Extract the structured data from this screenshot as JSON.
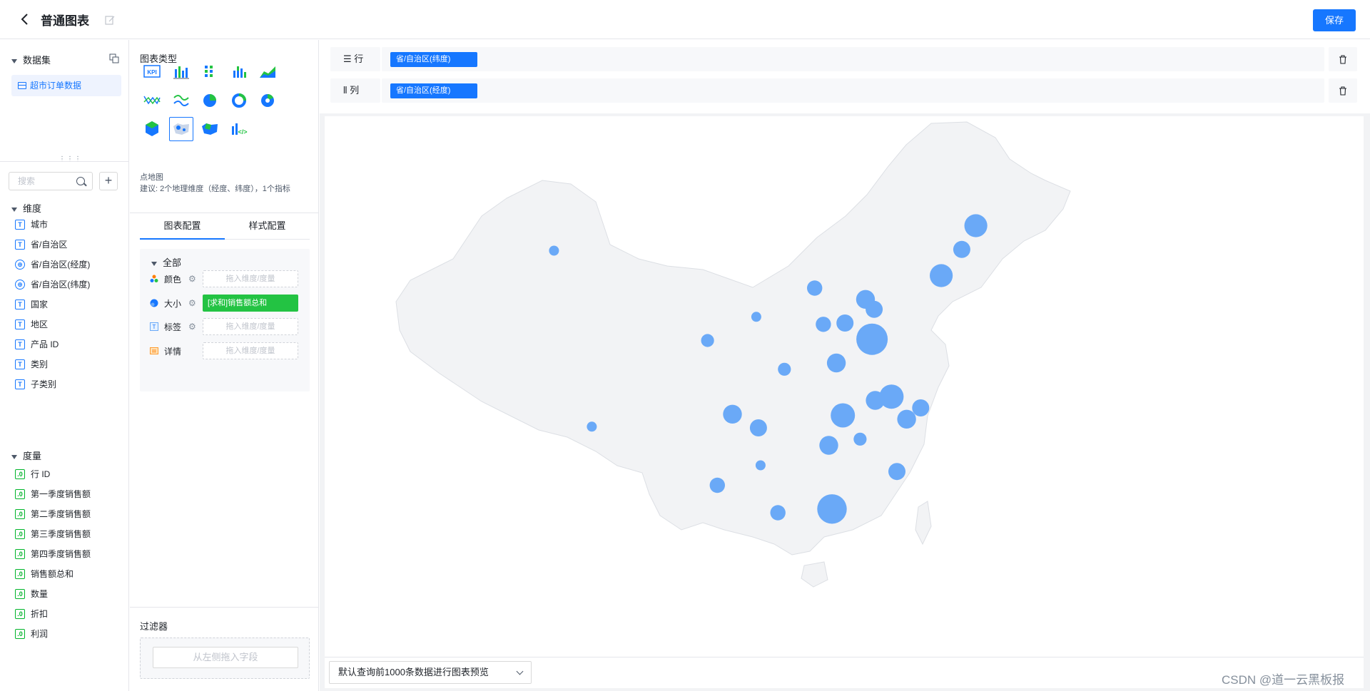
{
  "header": {
    "title": "普通图表",
    "save_label": "保存"
  },
  "left": {
    "dataset_section": "数据集",
    "dataset_item": "超市订单数据",
    "search_placeholder": "搜索",
    "dimension_section": "维度",
    "dimensions": [
      {
        "label": "城市",
        "type": "T"
      },
      {
        "label": "省/自治区",
        "type": "T"
      },
      {
        "label": "省/自治区(经度)",
        "type": "geo"
      },
      {
        "label": "省/自治区(纬度)",
        "type": "geo"
      },
      {
        "label": "国家",
        "type": "T"
      },
      {
        "label": "地区",
        "type": "T"
      },
      {
        "label": "产品 ID",
        "type": "T"
      },
      {
        "label": "类别",
        "type": "T"
      },
      {
        "label": "子类别",
        "type": "T"
      }
    ],
    "measure_section": "度量",
    "measures": [
      "行 ID",
      "第一季度销售额",
      "第二季度销售额",
      "第三季度销售额",
      "第四季度销售额",
      "销售额总和",
      "数量",
      "折扣",
      "利润"
    ]
  },
  "mid": {
    "chart_type_title": "图表类型",
    "chart_types": [
      "kpi-icon",
      "bar-chart-icon",
      "grouped-bar-icon",
      "stacked-bar-icon",
      "area-chart-icon",
      "line-chart-icon",
      "curve-chart-icon",
      "pie-chart-icon",
      "donut-chart-icon",
      "rose-chart-icon",
      "hex-map-icon",
      "point-map-icon",
      "region-map-icon",
      "custom-chart-icon"
    ],
    "selected_chart": "点地图",
    "hint": "建议: 2个地理维度（经度、纬度），1个指标",
    "tab_chart": "图表配置",
    "tab_style": "样式配置",
    "all_label": "全部",
    "rows": [
      {
        "label": "颜色",
        "value": "",
        "placeholder": "拖入维度/度量"
      },
      {
        "label": "大小",
        "value": "[求和]销售额总和",
        "placeholder": ""
      },
      {
        "label": "标签",
        "value": "",
        "placeholder": "拖入维度/度量"
      },
      {
        "label": "详情",
        "value": "",
        "placeholder": "拖入维度/度量"
      }
    ],
    "filter_title": "过滤器",
    "filter_placeholder": "从左侧拖入字段"
  },
  "shelves": {
    "row_label": "行",
    "row_pill": "省/自治区(纬度)",
    "col_label": "列",
    "col_pill": "省/自治区(经度)"
  },
  "footer": {
    "preview": "默认查询前1000条数据进行图表预览"
  },
  "watermark": "CSDN @道一云黑板报",
  "colors": {
    "accent": "#1677ff",
    "bubble": "#6aa9f7",
    "map_fill": "#f2f3f5",
    "green": "#23c343"
  },
  "map_bubbles": [
    {
      "lng": 126.6,
      "lat": 45.8,
      "v": 8
    },
    {
      "lng": 125.3,
      "lat": 43.9,
      "v": 4
    },
    {
      "lng": 123.4,
      "lat": 41.8,
      "v": 8
    },
    {
      "lng": 111.7,
      "lat": 40.8,
      "v": 3
    },
    {
      "lng": 116.4,
      "lat": 39.9,
      "v": 5
    },
    {
      "lng": 117.2,
      "lat": 39.1,
      "v": 4
    },
    {
      "lng": 114.5,
      "lat": 38.0,
      "v": 4
    },
    {
      "lng": 112.5,
      "lat": 37.9,
      "v": 3
    },
    {
      "lng": 117.0,
      "lat": 36.7,
      "v": 16
    },
    {
      "lng": 87.6,
      "lat": 43.8,
      "v": 1
    },
    {
      "lng": 101.8,
      "lat": 36.6,
      "v": 2
    },
    {
      "lng": 106.3,
      "lat": 38.5,
      "v": 1
    },
    {
      "lng": 91.1,
      "lat": 29.7,
      "v": 1
    },
    {
      "lng": 108.9,
      "lat": 34.3,
      "v": 2
    },
    {
      "lng": 113.7,
      "lat": 34.8,
      "v": 5
    },
    {
      "lng": 118.8,
      "lat": 32.1,
      "v": 9
    },
    {
      "lng": 117.3,
      "lat": 31.8,
      "v": 5
    },
    {
      "lng": 121.5,
      "lat": 31.2,
      "v": 4
    },
    {
      "lng": 114.3,
      "lat": 30.6,
      "v": 9
    },
    {
      "lng": 104.1,
      "lat": 30.7,
      "v": 5
    },
    {
      "lng": 106.5,
      "lat": 29.6,
      "v": 4
    },
    {
      "lng": 120.2,
      "lat": 30.3,
      "v": 5
    },
    {
      "lng": 113.0,
      "lat": 28.2,
      "v": 5
    },
    {
      "lng": 115.9,
      "lat": 28.7,
      "v": 2
    },
    {
      "lng": 106.7,
      "lat": 26.6,
      "v": 1
    },
    {
      "lng": 119.3,
      "lat": 26.1,
      "v": 4
    },
    {
      "lng": 102.7,
      "lat": 25.0,
      "v": 3
    },
    {
      "lng": 108.3,
      "lat": 22.8,
      "v": 3
    },
    {
      "lng": 113.3,
      "lat": 23.1,
      "v": 14
    }
  ]
}
